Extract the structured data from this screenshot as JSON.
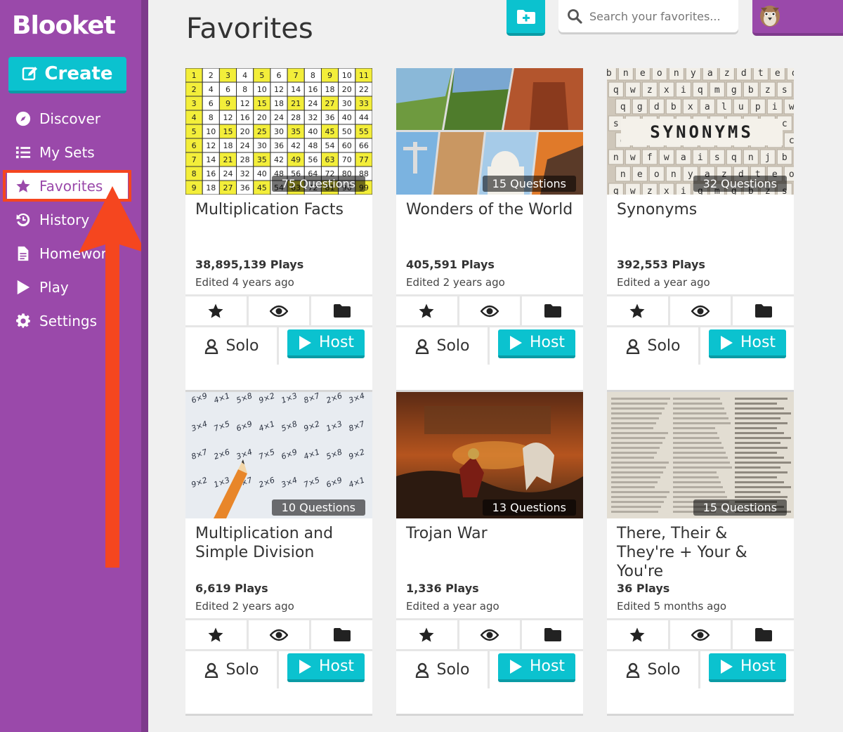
{
  "app": {
    "logo": "Blooket"
  },
  "sidebar": {
    "create_label": "Create",
    "items": [
      {
        "label": "Discover",
        "icon": "compass-icon"
      },
      {
        "label": "My Sets",
        "icon": "list-icon"
      },
      {
        "label": "Favorites",
        "icon": "star-icon",
        "active": true
      },
      {
        "label": "History",
        "icon": "history-icon"
      },
      {
        "label": "Homework",
        "icon": "document-icon"
      },
      {
        "label": "Play",
        "icon": "play-icon"
      },
      {
        "label": "Settings",
        "icon": "gear-icon"
      }
    ]
  },
  "header": {
    "title": "Favorites",
    "search_placeholder": "Search your favorites..."
  },
  "colors": {
    "sidebar": "#9a49aa",
    "accent": "#0bc2cf",
    "highlight": "#f5461f",
    "background": "#f0f0f0"
  },
  "cards": [
    {
      "questions": "75 Questions",
      "title": "Multiplication Facts",
      "plays": "38,895,139 Plays",
      "edited": "Edited 4 years ago",
      "solo": "Solo",
      "host": "Host"
    },
    {
      "questions": "15 Questions",
      "title": "Wonders of the World",
      "plays": "405,591 Plays",
      "edited": "Edited 2 years ago",
      "solo": "Solo",
      "host": "Host"
    },
    {
      "questions": "32 Questions",
      "title": "Synonyms",
      "plays": "392,553 Plays",
      "edited": "Edited a year ago",
      "solo": "Solo",
      "host": "Host"
    },
    {
      "questions": "10 Questions",
      "title": "Multiplication and Simple Division",
      "plays": "6,619 Plays",
      "edited": "Edited 2 years ago",
      "solo": "Solo",
      "host": "Host"
    },
    {
      "questions": "13 Questions",
      "title": "Trojan War",
      "plays": "1,336 Plays",
      "edited": "Edited a year ago",
      "solo": "Solo",
      "host": "Host"
    },
    {
      "questions": "15 Questions",
      "title": "There, Their & They're + Your & You're",
      "plays": "36 Plays",
      "edited": "Edited 5 months ago",
      "solo": "Solo",
      "host": "Host"
    }
  ]
}
